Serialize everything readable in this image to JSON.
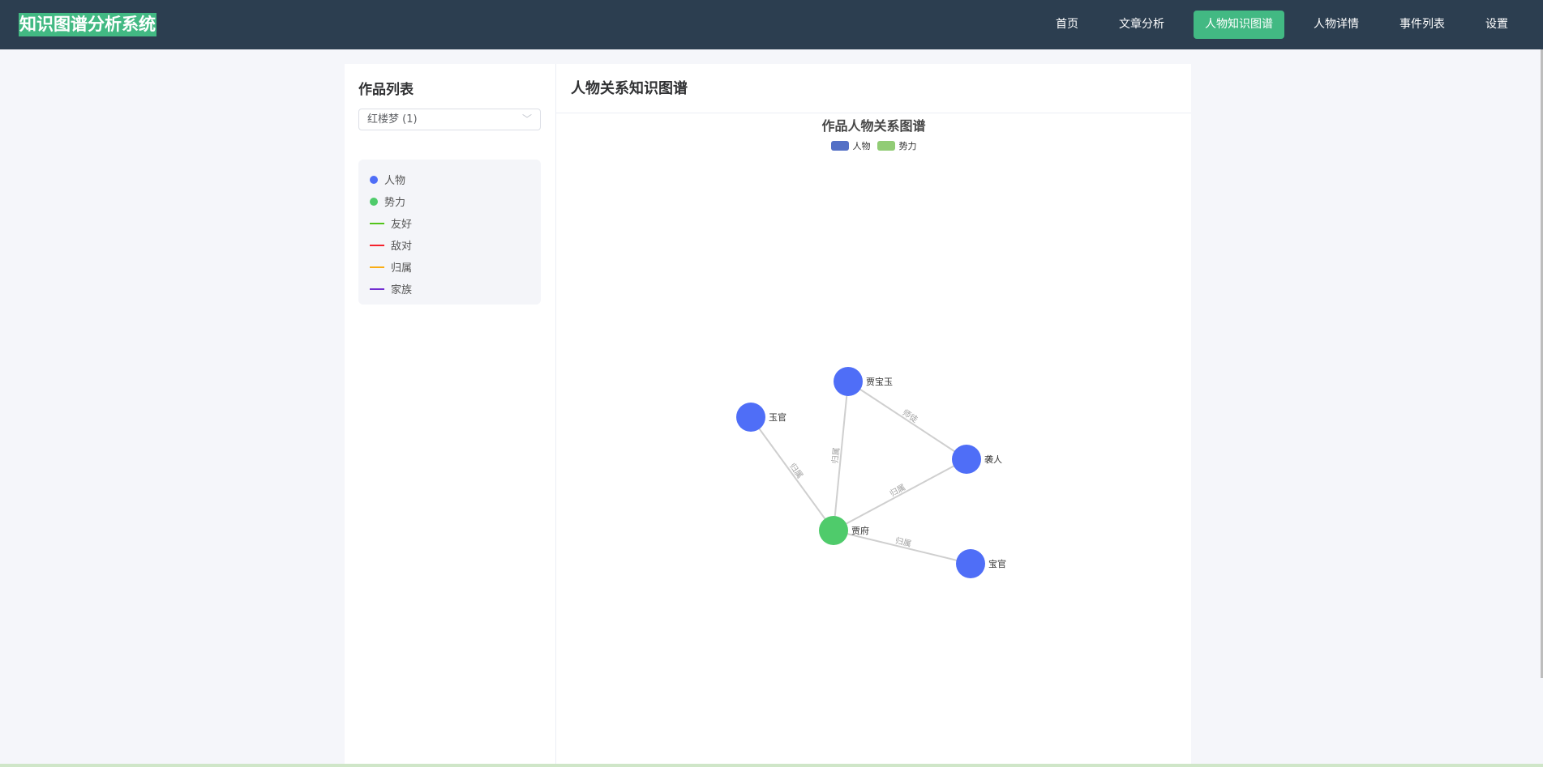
{
  "app": {
    "title": "知识图谱分析系统"
  },
  "nav": {
    "items": [
      {
        "label": "首页",
        "active": false
      },
      {
        "label": "文章分析",
        "active": false
      },
      {
        "label": "人物知识图谱",
        "active": true
      },
      {
        "label": "人物详情",
        "active": false
      },
      {
        "label": "事件列表",
        "active": false
      },
      {
        "label": "设置",
        "active": false
      }
    ]
  },
  "sidebar": {
    "title": "作品列表",
    "select_value": "红楼梦 (1)",
    "legend": [
      {
        "label": "人物",
        "kind": "dot",
        "color": "#4f6ef7"
      },
      {
        "label": "势力",
        "kind": "dot",
        "color": "#4fcb6b"
      },
      {
        "label": "友好",
        "kind": "line",
        "color": "#52c41a"
      },
      {
        "label": "敌对",
        "kind": "line",
        "color": "#f5222d"
      },
      {
        "label": "归属",
        "kind": "line",
        "color": "#faad14"
      },
      {
        "label": "家族",
        "kind": "line",
        "color": "#722ed1"
      }
    ]
  },
  "main": {
    "title": "人物关系知识图谱"
  },
  "chart_data": {
    "type": "graph",
    "title": "作品人物关系图谱",
    "legend": [
      {
        "name": "人物",
        "color": "#5470c6"
      },
      {
        "name": "势力",
        "color": "#91cc75"
      }
    ],
    "node_colors": {
      "人物": "#4f6ef7",
      "势力": "#4fcb6b"
    },
    "nodes": [
      {
        "name": "贾宝玉",
        "category": "人物"
      },
      {
        "name": "玉官",
        "category": "人物"
      },
      {
        "name": "袭人",
        "category": "人物"
      },
      {
        "name": "贾府",
        "category": "势力"
      },
      {
        "name": "宝官",
        "category": "人物"
      }
    ],
    "links": [
      {
        "source": "贾宝玉",
        "target": "袭人",
        "label": "师徒"
      },
      {
        "source": "贾宝玉",
        "target": "贾府",
        "label": "归属"
      },
      {
        "source": "玉官",
        "target": "贾府",
        "label": "归属"
      },
      {
        "source": "袭人",
        "target": "贾府",
        "label": "归属"
      },
      {
        "source": "贾府",
        "target": "宝官",
        "label": "归属"
      }
    ]
  }
}
